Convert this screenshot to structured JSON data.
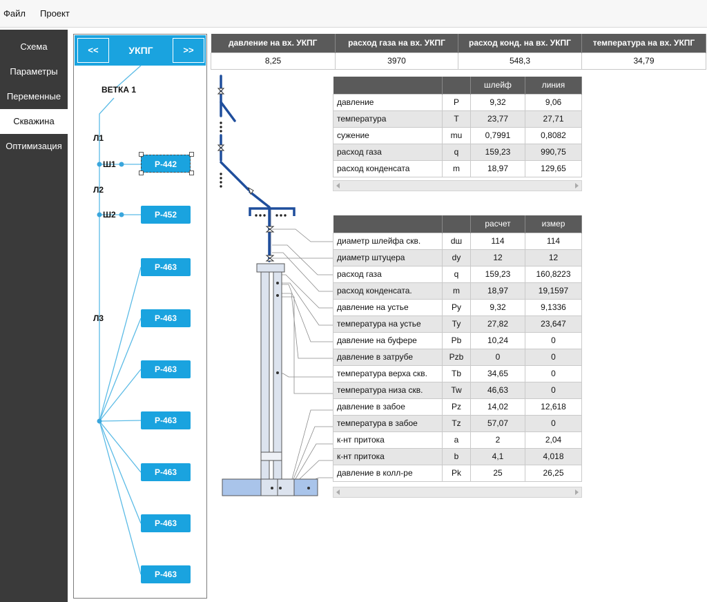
{
  "menu": {
    "file": "Файл",
    "project": "Проект"
  },
  "sidebar": {
    "items": [
      {
        "label": "Схема"
      },
      {
        "label": "Параметры"
      },
      {
        "label": "Переменные"
      },
      {
        "label": "Скважина"
      },
      {
        "label": "Оптимизация"
      }
    ],
    "active": "Скважина"
  },
  "tree": {
    "prev": "<<",
    "next": ">>",
    "title": "УКПГ",
    "branch": "ВЕТКА 1",
    "lines": {
      "l1": "Л1",
      "l2": "Л2",
      "l3": "Л3"
    },
    "chokes": {
      "sh1": "Ш1",
      "sh2": "Ш2"
    },
    "wells": [
      "Р-442",
      "Р-452",
      "Р-463",
      "Р-463",
      "Р-463",
      "Р-463",
      "Р-463",
      "Р-463",
      "Р-463"
    ]
  },
  "summary": {
    "headers": [
      "давление на вх. УКПГ",
      "расход газа на вх. УКПГ",
      "расход конд. на вх. УКПГ",
      "температура на вх. УКПГ"
    ],
    "values": [
      "8,25",
      "3970",
      "548,3",
      "34,79"
    ]
  },
  "flow_table": {
    "headers": [
      "",
      "",
      "шлейф",
      "линия"
    ],
    "rows": [
      [
        "давление",
        "P",
        "9,32",
        "9,06"
      ],
      [
        "температура",
        "T",
        "23,77",
        "27,71"
      ],
      [
        "сужение",
        "mu",
        "0,7991",
        "0,8082"
      ],
      [
        "расход газа",
        "q",
        "159,23",
        "990,75"
      ],
      [
        "расход конденсата",
        "m",
        "18,97",
        "129,65"
      ]
    ]
  },
  "well_table": {
    "headers": [
      "",
      "",
      "расчет",
      "измер"
    ],
    "rows": [
      [
        "диаметр шлейфа скв.",
        "dш",
        "114",
        "114"
      ],
      [
        "диаметр штуцера",
        "dy",
        "12",
        "12"
      ],
      [
        "расход газа",
        "q",
        "159,23",
        "160,8223"
      ],
      [
        "расход конденсата.",
        "m",
        "18,97",
        "19,1597"
      ],
      [
        "давление на устье",
        "Py",
        "9,32",
        "9,1336"
      ],
      [
        "температура на устье",
        "Ty",
        "27,82",
        "23,647"
      ],
      [
        "давление на буфере",
        "Pb",
        "10,24",
        "0"
      ],
      [
        "давление в затрубе",
        "Pzb",
        "0",
        "0"
      ],
      [
        "температура верха скв.",
        "Tb",
        "34,65",
        "0"
      ],
      [
        "температура низа скв.",
        "Tw",
        "46,63",
        "0"
      ],
      [
        "давление в забое",
        "Pz",
        "14,02",
        "12,618"
      ],
      [
        "температура в забое",
        "Tz",
        "57,07",
        "0"
      ],
      [
        "к-нт притока",
        "a",
        "2",
        "2,04"
      ],
      [
        "к-нт притока",
        "b",
        "4,1",
        "4,018"
      ],
      [
        "давление в колл-ре",
        "Pk",
        "25",
        "26,25"
      ]
    ]
  },
  "colors": {
    "accent": "#1aa3df",
    "sidebar": "#3a3a3a",
    "header": "#5a5a5a",
    "pipe": "#1f4e9c"
  }
}
